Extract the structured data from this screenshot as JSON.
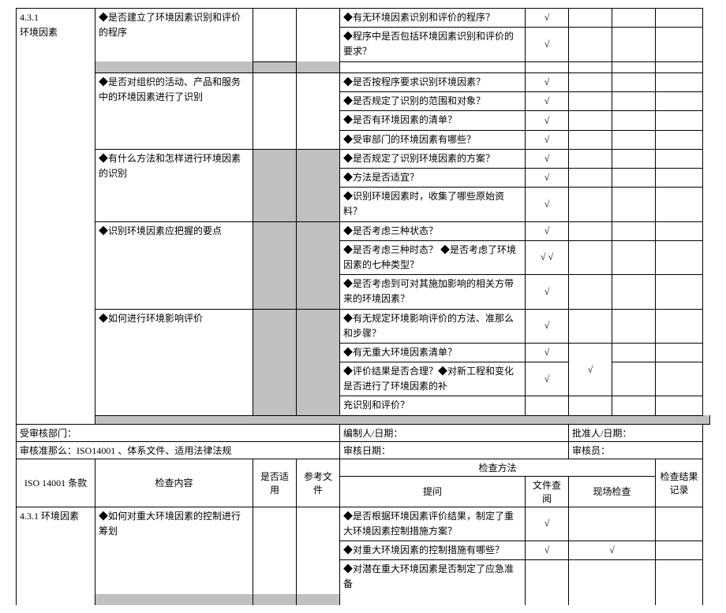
{
  "check": "√",
  "check2": "√ √",
  "section1": {
    "clause": "4.3.1",
    "clause_name": "环境因素",
    "rows": [
      {
        "content": "◆是否建立了环境因素识别和评价的程序",
        "questions": [
          {
            "t": "◆有无环境因素识别和评价的程序？",
            "c1": "√"
          },
          {
            "t": "◆程序中是否包括环境因素识别和评价的要求？",
            "c1": "√"
          }
        ]
      },
      {
        "content": "◆是否对组织的活动、产品和服务中的环境因素进行了识别",
        "questions": [
          {
            "t": "◆是否按程序要求识别环境因素？",
            "c1": "√"
          },
          {
            "t": "◆是否规定了识别的范围和对象？",
            "c1": "√"
          },
          {
            "t": "◆是否有环境因素的清单？",
            "c1": "√"
          },
          {
            "t": "◆受审部门的环境因素有哪些？",
            "c1": "√"
          }
        ]
      },
      {
        "content": "◆有什么方法和怎样进行环境因素的识别",
        "questions": [
          {
            "t": "◆是否规定了识别环境因素的方案？",
            "c1": "√"
          },
          {
            "t": "◆方法是否适宜？",
            "c1": "√"
          },
          {
            "t": "◆识别环境因素时，收集了哪些原始资料？",
            "c1": "√"
          }
        ]
      },
      {
        "content": "◆识别环境因素应把握的要点",
        "questions": [
          {
            "t": "◆是否考虑三种状态？",
            "c1": "√"
          },
          {
            "t": "◆是否考虑三种时态？ ◆是否考虑了环境因素的七种类型？",
            "c1": "√ √"
          },
          {
            "t": "◆是否考虑到可对其施加影响的相关方带来的环境因素？",
            "c1": "√"
          }
        ]
      },
      {
        "content": "◆如何进行环境影响评价",
        "questions": [
          {
            "t": "◆有无规定环境影响评价的方法、准那么和步骤？",
            "c1": "√"
          },
          {
            "t": "◆有无重大环境因素清单？",
            "c1": "√",
            "c2": "√"
          },
          {
            "t": "◆评价结果是否合理？◆对新工程和变化是否进行了环境因素的补",
            "c1": "√"
          },
          {
            "t": "充识别和评价？"
          }
        ]
      }
    ]
  },
  "meta": {
    "dept": "受审核部门：",
    "editor": "编制人/日期：",
    "approver": "批准人/日期：",
    "criteria": "审核准那么：ISO14001 、体系文件、适用法律法规",
    "auditdate": "审核日期：",
    "auditor": "审核员："
  },
  "header": {
    "h1": "ISO 14001 条款",
    "h2": "检查内容",
    "h3": "是否适用",
    "h4": "参考文件",
    "h5": "检查方法",
    "h6": "检查结果记录",
    "h5a": "提问",
    "h5b": "文件查阅",
    "h5c": "现场检查"
  },
  "section2": {
    "clause": "4.3.1 环境因素",
    "content": "◆如何对重大环境因素的控制进行筹划",
    "questions": [
      {
        "t": "◆是否根据环境因素评价结果，制定了重大环境因素控制措施方案？",
        "c1": "√"
      },
      {
        "t": "◆对重大环境因素的控制措施有哪些？",
        "c1": "√",
        "c2": "√"
      },
      {
        "t": "◆对潜在重大环境因素是否制定了应急准备"
      }
    ]
  }
}
